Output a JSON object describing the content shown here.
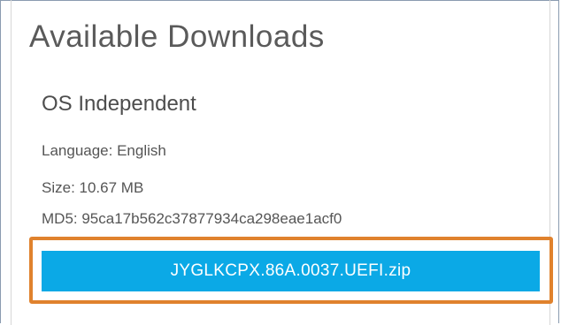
{
  "downloads": {
    "title": "Available Downloads",
    "os_label": "OS Independent",
    "language": "Language: English",
    "size": "Size: 10.67 MB",
    "md5": "MD5: 95ca17b562c37877934ca298eae1acf0",
    "download_file": "JYGLKCPX.86A.0037.UEFI.zip"
  },
  "colors": {
    "button": "#0ba9e6",
    "highlight": "#e0822d",
    "text": "#555555"
  }
}
